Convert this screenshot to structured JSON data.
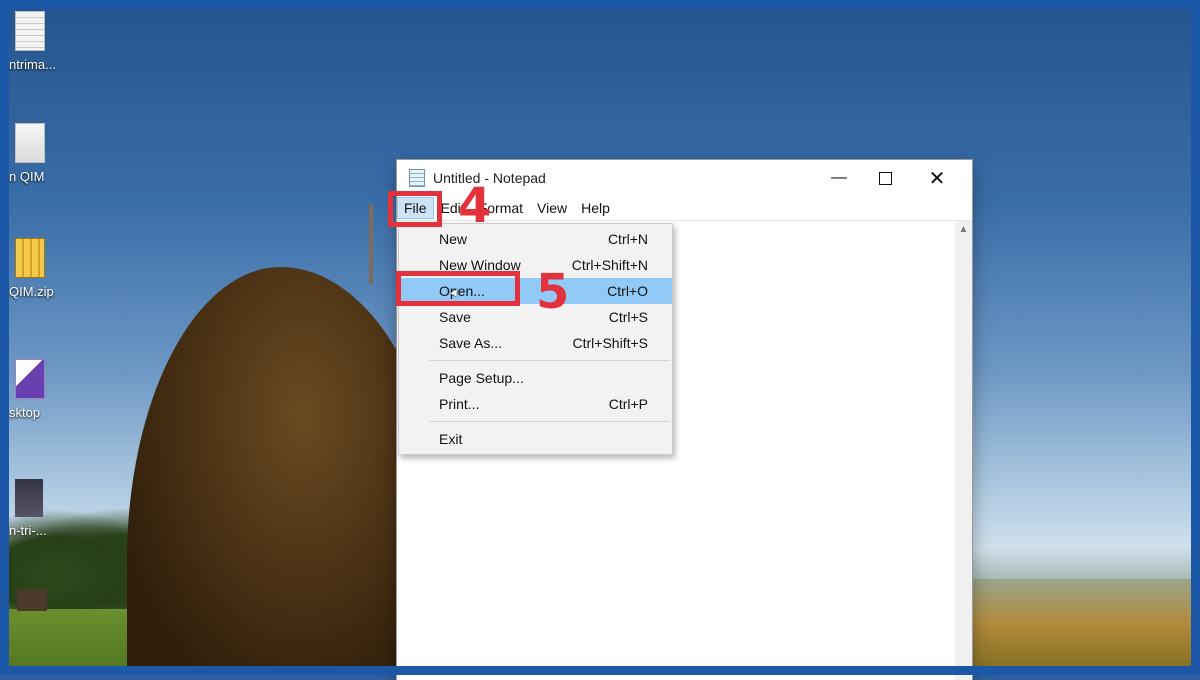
{
  "desktop": {
    "icons": [
      {
        "label": "ntrima...",
        "icon": "text-document-icon"
      },
      {
        "label": "n QIM",
        "icon": "folder-icon"
      },
      {
        "label": "QIM.zip",
        "icon": "zip-folder-icon"
      },
      {
        "label": "sktop",
        "icon": "app-shortcut-icon"
      },
      {
        "label": "n-tri-...",
        "icon": "shortcut-icon"
      }
    ]
  },
  "notepad": {
    "title": "Untitled - Notepad",
    "controls": {
      "minimize": "—",
      "close": "✕"
    },
    "menu": [
      "File",
      "Edit",
      "Format",
      "View",
      "Help"
    ],
    "active_menu": "File",
    "file_menu": {
      "groups": [
        [
          {
            "label": "New",
            "shortcut": "Ctrl+N"
          },
          {
            "label": "New Window",
            "shortcut": "Ctrl+Shift+N"
          },
          {
            "label": "Open...",
            "shortcut": "Ctrl+O",
            "highlighted": true
          },
          {
            "label": "Save",
            "shortcut": "Ctrl+S"
          },
          {
            "label": "Save As...",
            "shortcut": "Ctrl+Shift+S"
          }
        ],
        [
          {
            "label": "Page Setup...",
            "shortcut": ""
          },
          {
            "label": "Print...",
            "shortcut": "Ctrl+P"
          }
        ],
        [
          {
            "label": "Exit",
            "shortcut": ""
          }
        ]
      ]
    },
    "scroll_up_arrow": "▲"
  },
  "annotations": [
    {
      "number": "4",
      "target": "File menu"
    },
    {
      "number": "5",
      "target": "Open..."
    }
  ],
  "colors": {
    "annotation": "#e3323b",
    "highlight": "#91c9f7",
    "frame": "#1d58a8"
  }
}
